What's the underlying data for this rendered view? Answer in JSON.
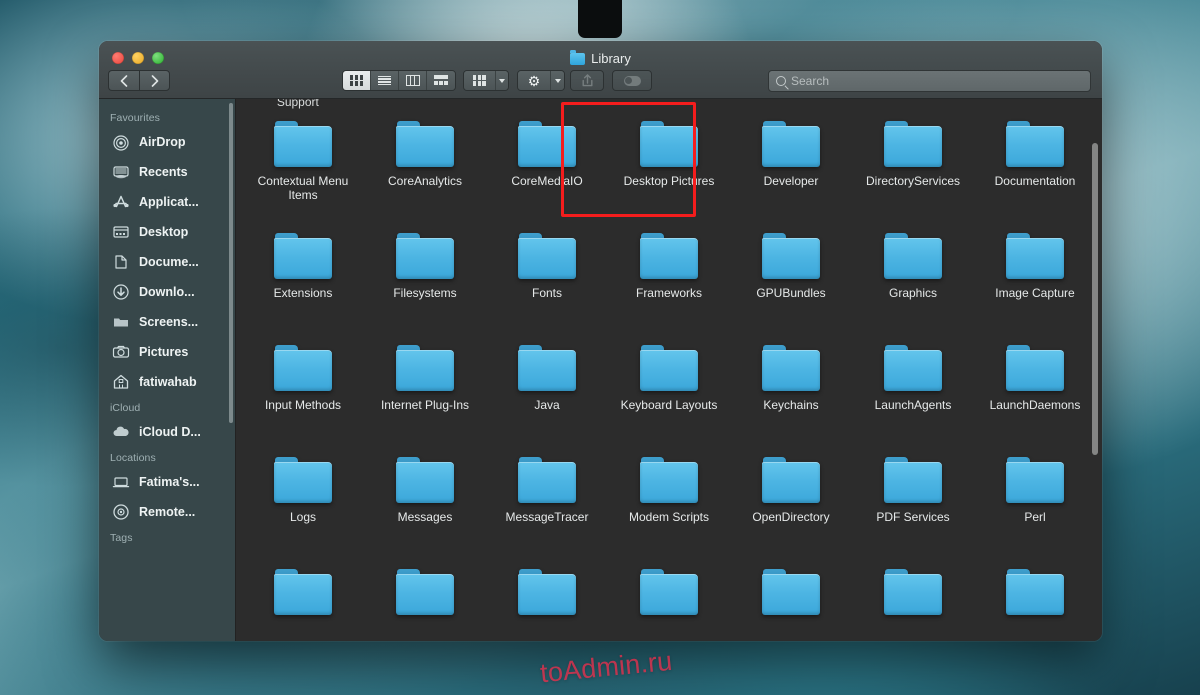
{
  "window": {
    "title": "Library",
    "title_icon": "folder-icon",
    "traffic_lights": [
      {
        "name": "close",
        "label": "Close",
        "color": "#e8433a"
      },
      {
        "name": "minimize",
        "label": "Minimize",
        "color": "#e8a723"
      },
      {
        "name": "maximize",
        "label": "Maximize",
        "color": "#27ad2b"
      }
    ]
  },
  "toolbar": {
    "back_label": "Back",
    "forward_label": "Forward",
    "view_modes": [
      {
        "name": "icon-view",
        "label": "Icon View",
        "icon": "grid-icon",
        "active": true
      },
      {
        "name": "list-view",
        "label": "List View",
        "icon": "list-icon",
        "active": false
      },
      {
        "name": "column-view",
        "label": "Column View",
        "icon": "columns-icon",
        "active": false
      },
      {
        "name": "gallery-view",
        "label": "Gallery View",
        "icon": "gallery-icon",
        "active": false
      }
    ],
    "arrange_label": "Group items",
    "arrange_icon": "grid-icon",
    "action_label": "Action",
    "action_icon": "gear-icon",
    "share_label": "Share",
    "share_icon": "share-icon",
    "tag_label": "Edit Tags",
    "tag_icon": "tag-icon"
  },
  "search": {
    "placeholder": "Search",
    "value": "",
    "icon": "search-icon"
  },
  "sidebar": {
    "sections": [
      {
        "header": "Favourites",
        "items": [
          {
            "label": "AirDrop",
            "icon": "airdrop-icon"
          },
          {
            "label": "Recents",
            "icon": "clock-icon"
          },
          {
            "label": "Applicat...",
            "icon": "applications-icon"
          },
          {
            "label": "Desktop",
            "icon": "desktop-icon"
          },
          {
            "label": "Docume...",
            "icon": "documents-icon"
          },
          {
            "label": "Downlo...",
            "icon": "downloads-icon"
          },
          {
            "label": "Screens...",
            "icon": "folder-icon"
          },
          {
            "label": "Pictures",
            "icon": "camera-icon"
          },
          {
            "label": "fatiwahab",
            "icon": "home-icon"
          }
        ]
      },
      {
        "header": "iCloud",
        "items": [
          {
            "label": "iCloud D...",
            "icon": "cloud-icon"
          }
        ]
      },
      {
        "header": "Locations",
        "items": [
          {
            "label": "Fatima's...",
            "icon": "laptop-icon"
          },
          {
            "label": "Remote...",
            "icon": "disc-icon"
          }
        ]
      },
      {
        "header": "Tags",
        "items": []
      }
    ]
  },
  "content": {
    "clipped_top_label": "Support",
    "folders": [
      {
        "label": "Contextual Menu Items",
        "highlighted": false
      },
      {
        "label": "CoreAnalytics",
        "highlighted": false
      },
      {
        "label": "CoreMediaIO",
        "highlighted": false
      },
      {
        "label": "Desktop Pictures",
        "highlighted": true
      },
      {
        "label": "Developer",
        "highlighted": false
      },
      {
        "label": "DirectoryServices",
        "highlighted": false
      },
      {
        "label": "Documentation",
        "highlighted": false
      },
      {
        "label": "Extensions",
        "highlighted": false
      },
      {
        "label": "Filesystems",
        "highlighted": false
      },
      {
        "label": "Fonts",
        "highlighted": false
      },
      {
        "label": "Frameworks",
        "highlighted": false
      },
      {
        "label": "GPUBundles",
        "highlighted": false
      },
      {
        "label": "Graphics",
        "highlighted": false
      },
      {
        "label": "Image Capture",
        "highlighted": false
      },
      {
        "label": "Input Methods",
        "highlighted": false
      },
      {
        "label": "Internet Plug-Ins",
        "highlighted": false
      },
      {
        "label": "Java",
        "highlighted": false
      },
      {
        "label": "Keyboard Layouts",
        "highlighted": false
      },
      {
        "label": "Keychains",
        "highlighted": false
      },
      {
        "label": "LaunchAgents",
        "highlighted": false
      },
      {
        "label": "LaunchDaemons",
        "highlighted": false
      },
      {
        "label": "Logs",
        "highlighted": false
      },
      {
        "label": "Messages",
        "highlighted": false
      },
      {
        "label": "MessageTracer",
        "highlighted": false
      },
      {
        "label": "Modem Scripts",
        "highlighted": false
      },
      {
        "label": "OpenDirectory",
        "highlighted": false
      },
      {
        "label": "PDF Services",
        "highlighted": false
      },
      {
        "label": "Perl",
        "highlighted": false
      },
      {
        "label": "",
        "highlighted": false
      },
      {
        "label": "",
        "highlighted": false
      },
      {
        "label": "",
        "highlighted": false
      },
      {
        "label": "",
        "highlighted": false
      },
      {
        "label": "",
        "highlighted": false
      },
      {
        "label": "",
        "highlighted": false
      },
      {
        "label": "",
        "highlighted": false
      }
    ]
  },
  "annotation": {
    "highlight_color": "#f41d1d",
    "highlight_target": "Desktop Pictures"
  },
  "watermark": {
    "text": "toAdmin.ru",
    "color": "#e0304d"
  }
}
